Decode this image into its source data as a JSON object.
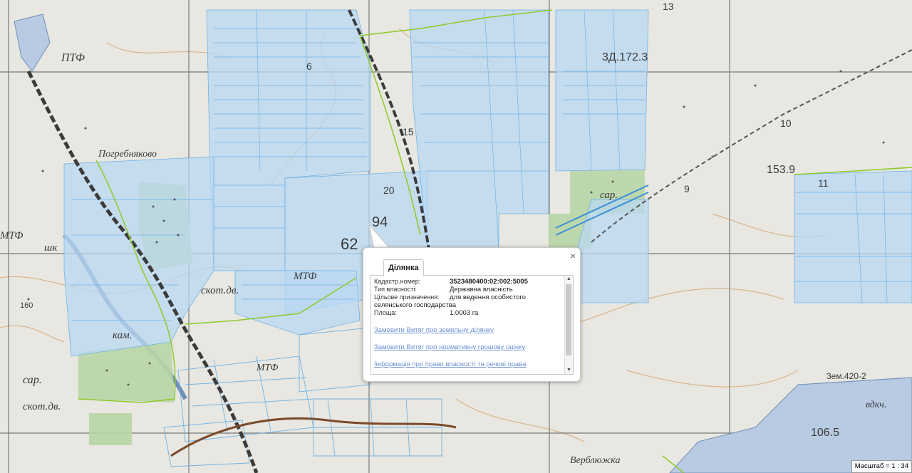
{
  "map": {
    "labels": {
      "ptf": "ПТФ",
      "pogrebnyakovo": "Погребняково",
      "mtf_left": "МТФ",
      "shk": "шк",
      "skot_dv": "скот.дв.",
      "kam": "кам.",
      "sar_left": "сар.",
      "skot_dv2": "скот.дв.",
      "mtf_mid": "МТФ",
      "mtf_low": "МТФ",
      "sar_right": "сар.",
      "zd": "3Д.172.3",
      "h153": "153.9",
      "n20": "20",
      "n94": "94",
      "n62": "62",
      "n15": "15",
      "n6": "6",
      "n9": "9",
      "n10": "10",
      "n11": "11",
      "n13": "13",
      "zem": "3ем.420-2",
      "vdkch": "вдкч.",
      "h106": "106.5",
      "verbl": "Верблюжка",
      "n160": "160"
    }
  },
  "popup": {
    "tab_label": "Ділянка",
    "close_label": "×",
    "fields": [
      {
        "key": "Кадастр.номер:",
        "value": "3523480400:02:002:5005"
      },
      {
        "key": "Тип власності:",
        "value": "Державна власність"
      },
      {
        "key": "Цільове призначення:",
        "value": "для ведення особистого"
      }
    ],
    "purpose_cont": "селянського господарства",
    "area_key": "Площа:",
    "area_value": "1.0003 га",
    "links": [
      "Замовити Витяг про земельну ділянку",
      "Замовити Витяг про нормативну грошову оцінку",
      "Інформація про право власності та речові права"
    ]
  },
  "scale": {
    "label": "Масштаб = 1 : 34"
  }
}
